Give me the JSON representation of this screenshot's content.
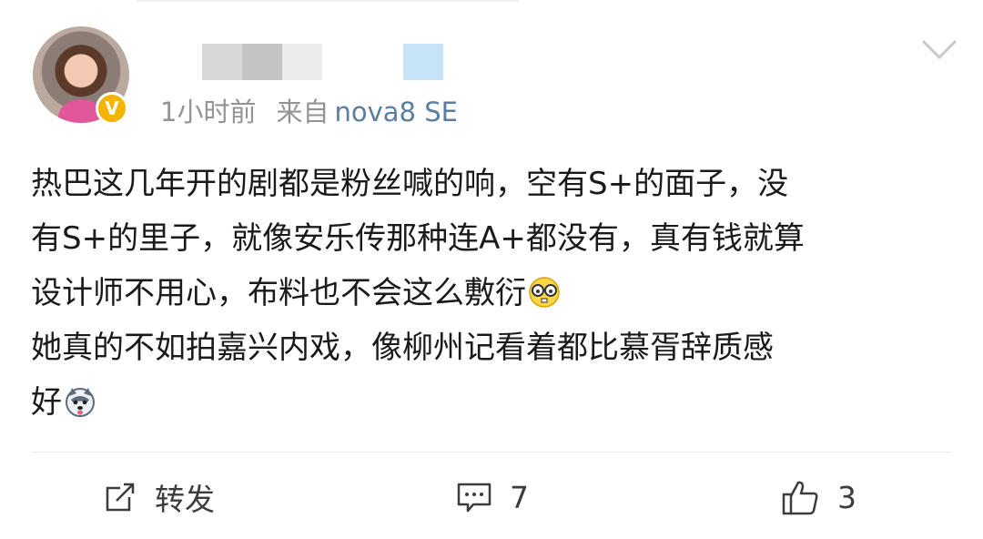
{
  "post": {
    "avatar_icon": "user-avatar",
    "badge_icon": "verified-v-badge",
    "badge_glyph": "V",
    "time": "1小时前",
    "source_prefix": "来自",
    "source_device": "nova8 SE",
    "content_lines": [
      "热巴这几年开的剧都是粉丝喊的响，空有S+的面子，没",
      "有S+的里子，就像安乐传那种连A+都没有，真有钱就算",
      "设计师不用心，布料也不会这么敷衍",
      "她真的不如拍嘉兴内戏，像柳州记看着都比慕胥辞质感",
      "好"
    ],
    "emojis": [
      "nerd-glasses-emoji",
      "husky-dog-emoji"
    ]
  },
  "actions": {
    "repost_label": "转发",
    "comment_count": "7",
    "like_count": "3"
  },
  "colors": {
    "meta_gray": "#939393",
    "device_blue": "#5b7ea0",
    "badge_yellow": "#f4b400",
    "text": "#1a1a1a"
  }
}
